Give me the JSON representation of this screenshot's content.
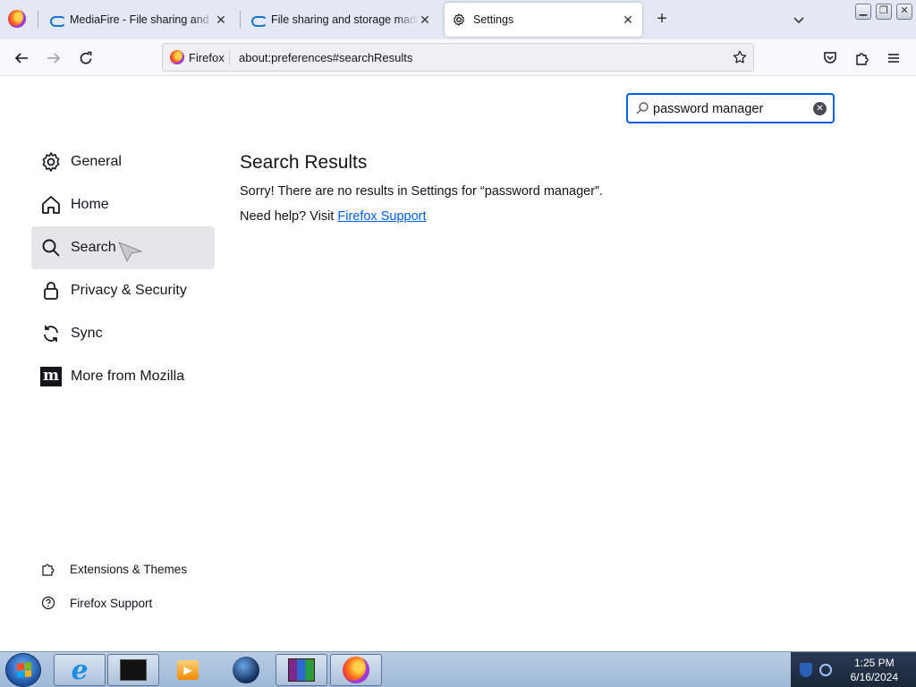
{
  "tabs": [
    {
      "label": "MediaFire - File sharing and storage made simple",
      "icon": "mediafire-icon",
      "active": false
    },
    {
      "label": "File sharing and storage made simple",
      "icon": "mediafire-icon",
      "active": false
    },
    {
      "label": "Settings",
      "icon": "gear-icon",
      "active": true
    }
  ],
  "urlbar": {
    "identity": "Firefox",
    "url": "about:preferences#searchResults"
  },
  "search": {
    "value": "password manager"
  },
  "sidebar": {
    "categories": [
      {
        "label": "General",
        "icon": "gear-icon"
      },
      {
        "label": "Home",
        "icon": "home-icon"
      },
      {
        "label": "Search",
        "icon": "search-icon",
        "selected": true
      },
      {
        "label": "Privacy & Security",
        "icon": "lock-icon"
      },
      {
        "label": "Sync",
        "icon": "sync-icon"
      },
      {
        "label": "More from Mozilla",
        "icon": "mozilla-icon"
      }
    ],
    "footer": [
      {
        "label": "Extensions & Themes",
        "icon": "puzzle-icon"
      },
      {
        "label": "Firefox Support",
        "icon": "help-icon"
      }
    ]
  },
  "results": {
    "heading": "Search Results",
    "message": "Sorry! There are no results in Settings for “password manager”.",
    "help_prefix": "Need help? Visit ",
    "help_link": "Firefox Support"
  },
  "taskbar": {
    "apps": [
      "internet-explorer",
      "terminal",
      "media-player",
      "network",
      "winrar",
      "firefox"
    ],
    "time": "1:25 PM",
    "date": "6/16/2024"
  },
  "colors": {
    "accent": "#0061e0",
    "selected_bg": "#e6e6ea"
  }
}
